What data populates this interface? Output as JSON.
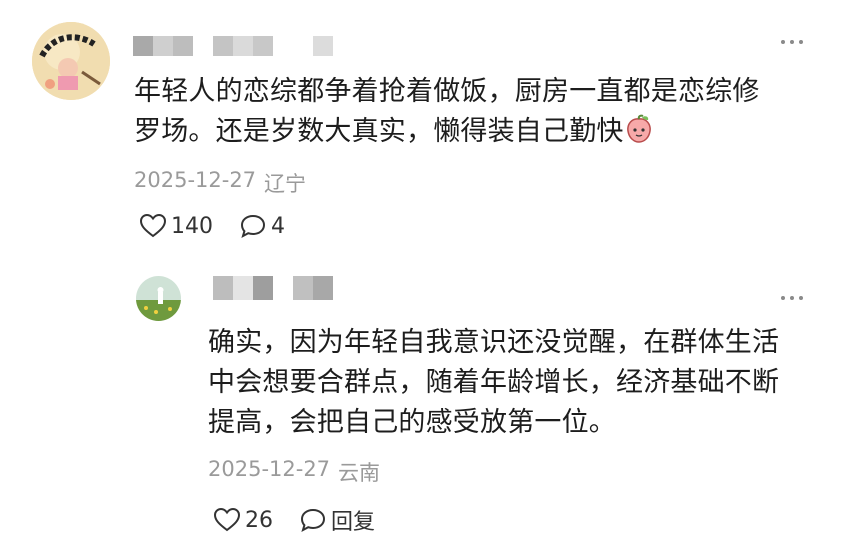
{
  "comments": [
    {
      "text_line1": "年轻人的恋综都争着抢着做饭，厨房一直都是恋综修",
      "text_line2": "罗场。还是岁数大真实，懒得装自己勤快",
      "emoji": "peach-face-emoji",
      "date": "2025-12-27",
      "location": "辽宁",
      "likes": "140",
      "replies": "4"
    },
    {
      "text_line1": "确实，因为年轻自我意识还没觉醒，在群体生活",
      "text_line2": "中会想要合群点，随着年龄增长，经济基础不断",
      "text_line3": "提高，会把自己的感受放第一位。",
      "date": "2025-12-27",
      "location": "云南",
      "likes": "26",
      "reply_label": "回复"
    }
  ],
  "colors": {
    "text": "#1d1d1d",
    "meta": "#9a9a9a",
    "icon": "#333333",
    "blur": "#cfcfcf"
  }
}
